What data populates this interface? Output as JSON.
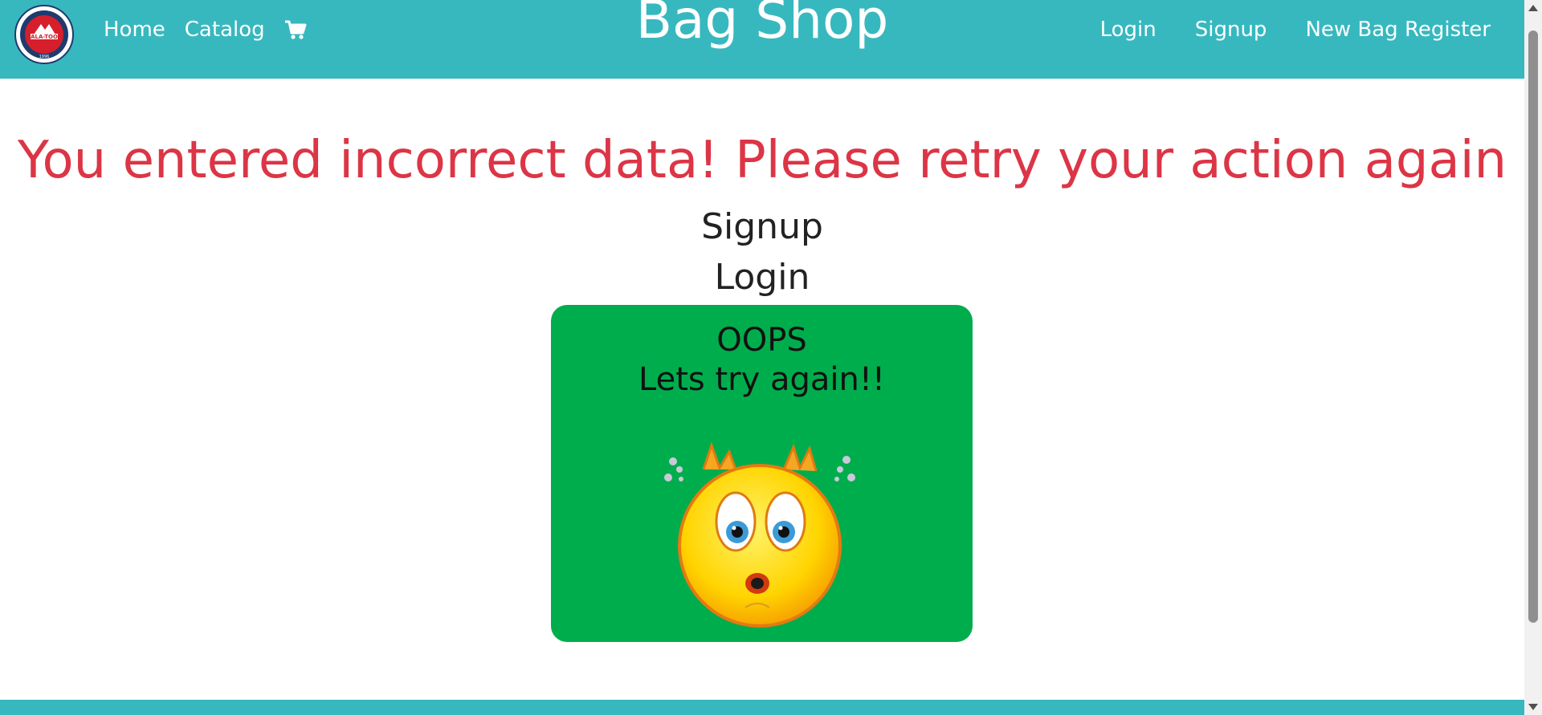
{
  "header": {
    "logo_text": "ALA-TOO",
    "logo_year": "1996",
    "nav_left": [
      "Home",
      "Catalog"
    ],
    "brand": "Bag Shop",
    "nav_right": [
      "Login",
      "Signup",
      "New Bag Register"
    ],
    "icons": {
      "cart": "cart-icon",
      "logo": "logo-icon"
    }
  },
  "main": {
    "error_message": "You entered incorrect data! Please retry your action again",
    "links": [
      "Signup",
      "Login"
    ],
    "oops_card": {
      "line1": "OOPS",
      "line2": "Lets try again!!"
    }
  },
  "colors": {
    "header_bg": "#37b8bf",
    "error_text": "#dc3546",
    "card_bg": "#00ad4c"
  }
}
